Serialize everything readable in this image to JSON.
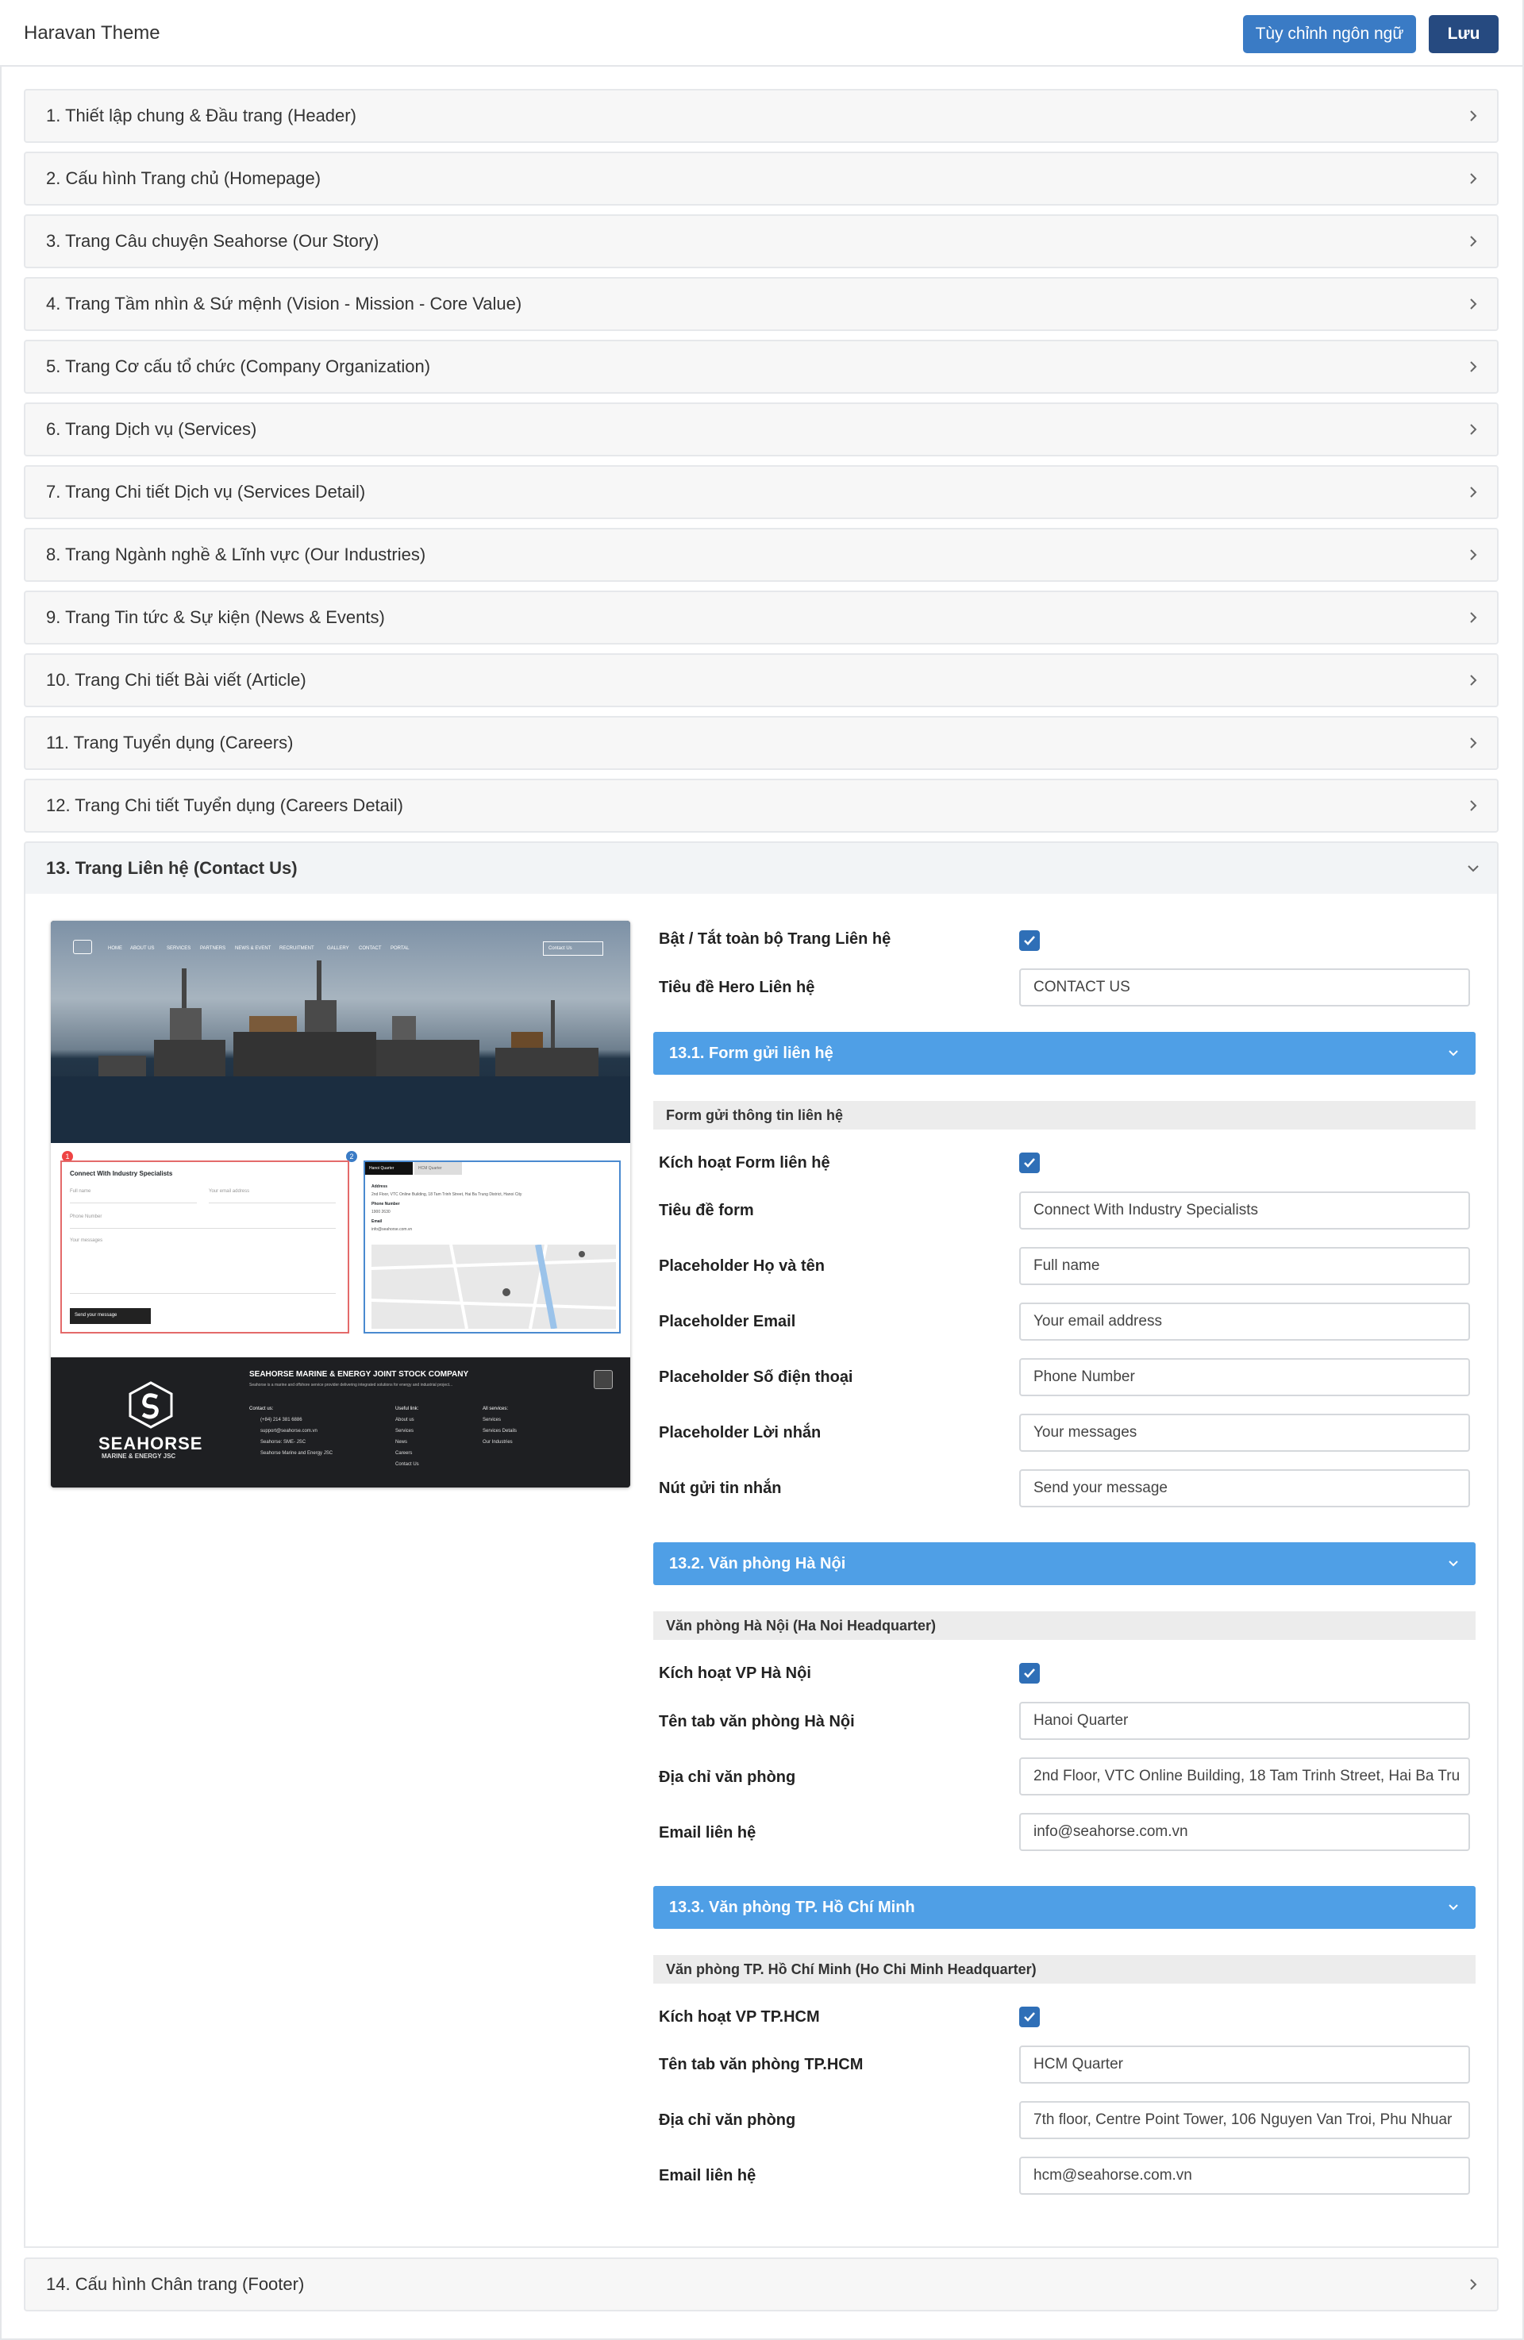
{
  "app": {
    "title": "Haravan Theme",
    "lang_button": "Tùy chỉnh ngôn ngữ",
    "save_button": "Lưu"
  },
  "accordion": [
    {
      "label": "1. Thiết lập chung & Đầu trang (Header)"
    },
    {
      "label": "2. Cấu hình Trang chủ (Homepage)"
    },
    {
      "label": "3. Trang Câu chuyện Seahorse (Our Story)"
    },
    {
      "label": "4. Trang Tầm nhìn & Sứ mệnh (Vision - Mission - Core Value)"
    },
    {
      "label": "5. Trang Cơ cấu tổ chức (Company Organization)"
    },
    {
      "label": "6. Trang Dịch vụ (Services)"
    },
    {
      "label": "7. Trang Chi tiết Dịch vụ (Services Detail)"
    },
    {
      "label": "8. Trang Ngành nghề & Lĩnh vực (Our Industries)"
    },
    {
      "label": "9. Trang Tin tức & Sự kiện (News & Events)"
    },
    {
      "label": "10. Trang Chi tiết Bài viết (Article)"
    },
    {
      "label": "11. Trang Tuyển dụng (Careers)"
    },
    {
      "label": "12. Trang Chi tiết Tuyển dụng (Careers Detail)"
    },
    {
      "label": "13. Trang Liên hệ (Contact Us)"
    },
    {
      "label": "14. Cấu hình Chân trang (Footer)"
    }
  ],
  "contact": {
    "enable_all_label": "Bật / Tắt toàn bộ Trang Liên hệ",
    "enable_all_checked": true,
    "hero_title_label": "Tiêu đề Hero Liên hệ",
    "hero_title_value": "CONTACT US",
    "form_section": {
      "title": "13.1. Form gửi liên hệ",
      "subtitle": "Form gửi thông tin liên hệ",
      "enable_label": "Kích hoạt Form liên hệ",
      "enable_checked": true,
      "fields": [
        {
          "label": "Tiêu đề form",
          "value": "Connect With Industry Specialists"
        },
        {
          "label": "Placeholder Họ và tên",
          "value": "Full name"
        },
        {
          "label": "Placeholder Email",
          "value": "Your email address"
        },
        {
          "label": "Placeholder Số điện thoại",
          "value": "Phone Number"
        },
        {
          "label": "Placeholder Lời nhắn",
          "value": "Your messages"
        },
        {
          "label": "Nút gửi tin nhắn",
          "value": "Send your message"
        }
      ]
    },
    "hanoi_section": {
      "title": "13.2. Văn phòng Hà Nội",
      "subtitle": "Văn phòng Hà Nội (Ha Noi Headquarter)",
      "enable_label": "Kích hoạt VP Hà Nội",
      "enable_checked": true,
      "fields": [
        {
          "label": "Tên tab văn phòng Hà Nội",
          "value": "Hanoi Quarter"
        },
        {
          "label": "Địa chỉ văn phòng",
          "value": "2nd Floor, VTC Online Building, 18 Tam Trinh Street, Hai Ba Tru"
        },
        {
          "label": "Email liên hệ",
          "value": "info@seahorse.com.vn"
        }
      ]
    },
    "hcm_section": {
      "title": "13.3. Văn phòng TP. Hồ Chí Minh",
      "subtitle": "Văn phòng TP. Hồ Chí Minh (Ho Chi Minh Headquarter)",
      "enable_label": "Kích hoạt VP TP.HCM",
      "enable_checked": true,
      "fields": [
        {
          "label": "Tên tab văn phòng TP.HCM",
          "value": "HCM Quarter"
        },
        {
          "label": "Địa chỉ văn phòng",
          "value": "7th floor, Centre Point Tower, 106 Nguyen Van Troi, Phu Nhuar"
        },
        {
          "label": "Email liên hệ",
          "value": "hcm@seahorse.com.vn"
        }
      ]
    }
  },
  "preview": {
    "nav_items": [
      "HOME",
      "ABOUT US",
      "SERVICES",
      "PARTNERS",
      "NEWS & EVENT",
      "RECRUITMENT",
      "GALLERY",
      "CONTACT",
      "PORTAL"
    ],
    "nav_button": "Contact Us",
    "badge_1": "1",
    "badge_2": "2",
    "form_title": "Connect With Industry Specialists",
    "form_full_name": "Full name",
    "form_email": "Your email address",
    "form_phone": "Phone Number",
    "form_message": "Your messages",
    "form_button": "Send your message",
    "tab_hanoi": "Hanoi Quarter",
    "tab_hcm": "HCM Quarter",
    "address_label": "Address",
    "address_value": "2nd Floor, VTC Online Building, 18 Tam Trinh Street, Hai Ba Trung District, Hanoi City",
    "phone_label": "Phone Number",
    "phone_value": "1900 2630",
    "email_label": "Email",
    "email_value": "info@seahorse.com.vn",
    "footer_company": "SEAHORSE MARINE & ENERGY JOINT STOCK COMPANY",
    "footer_desc": "Seahorse is a marine and offshore service provider delivering integrated solutions for energy and industrial project...",
    "footer_brand": "SEAHORSE",
    "footer_brand_sub": "MARINE & ENERGY JSC",
    "footer_contact_title": "Contact us:",
    "footer_contact": [
      "(+84) 214 381 6886",
      "support@seahorse.com.vn",
      "Seahorse: SME- JSC",
      "Seahorse Marine and Energy JSC"
    ],
    "footer_links_title": "Useful link:",
    "footer_links": [
      "About us",
      "Services",
      "News",
      "Careers",
      "Contact Us"
    ],
    "footer_services_title": "All services:",
    "footer_services": [
      "Services",
      "Services Details",
      "Our Industries"
    ]
  },
  "colors": {
    "primary": "#4f9fe6",
    "save": "#264a80",
    "lang": "#3a7bc5",
    "checkbox": "#2f6fb7"
  }
}
